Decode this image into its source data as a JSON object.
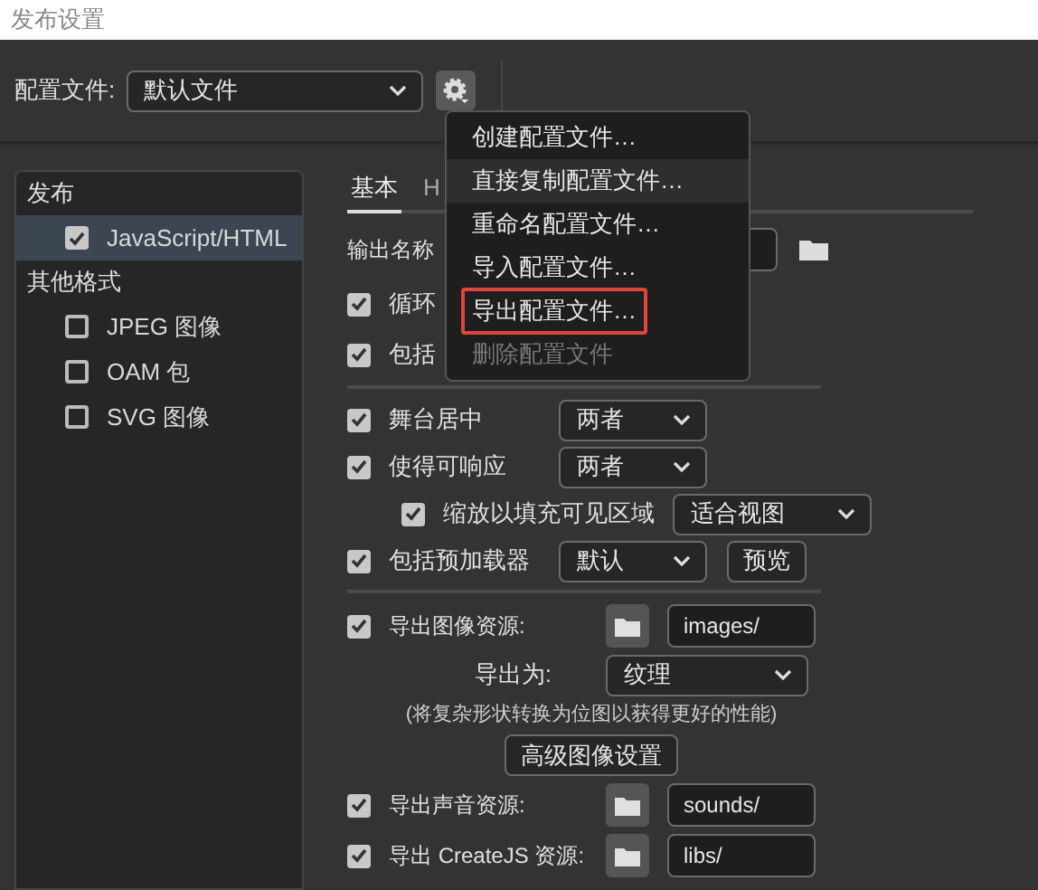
{
  "window": {
    "title": "发布设置"
  },
  "profile": {
    "label": "配置文件:",
    "value": "默认文件"
  },
  "menu": {
    "items": [
      {
        "label": "创建配置文件…",
        "hovered": false,
        "highlighted": false,
        "disabled": false
      },
      {
        "label": "直接复制配置文件…",
        "hovered": true,
        "highlighted": false,
        "disabled": false
      },
      {
        "label": "重命名配置文件…",
        "hovered": false,
        "highlighted": false,
        "disabled": false
      },
      {
        "label": "导入配置文件…",
        "hovered": false,
        "highlighted": false,
        "disabled": false
      },
      {
        "label": "导出配置文件…",
        "hovered": false,
        "highlighted": true,
        "disabled": false
      },
      {
        "label": "删除配置文件",
        "hovered": false,
        "highlighted": false,
        "disabled": true
      }
    ]
  },
  "sidebar": {
    "sections": [
      {
        "title": "发布",
        "items": [
          {
            "label": "JavaScript/HTML",
            "checked": true,
            "selected": true
          }
        ]
      },
      {
        "title": "其他格式",
        "items": [
          {
            "label": "JPEG 图像",
            "checked": false,
            "selected": false
          },
          {
            "label": "OAM 包",
            "checked": false,
            "selected": false
          },
          {
            "label": "SVG 图像",
            "checked": false,
            "selected": false
          }
        ]
      }
    ]
  },
  "tabs": [
    {
      "label": "基本",
      "selected": true
    },
    {
      "label": "H",
      "selected": false
    }
  ],
  "output_name": {
    "label": "输出名称"
  },
  "groups": [
    [
      {
        "kind": "check",
        "label": "循环",
        "checked": true
      },
      {
        "kind": "check",
        "label": "包括",
        "checked": true
      }
    ],
    [
      {
        "kind": "check_select",
        "label": "舞台居中",
        "checked": true,
        "value": "两者"
      },
      {
        "kind": "check_select",
        "label": "使得可响应",
        "checked": true,
        "value": "两者",
        "children": [
          {
            "kind": "check_select",
            "label": "缩放以填充可见区域",
            "checked": true,
            "value": "适合视图"
          }
        ]
      },
      {
        "kind": "check_select",
        "label": "包括预加载器",
        "checked": true,
        "value": "默认",
        "button": "预览"
      }
    ],
    [
      {
        "kind": "check_folder",
        "label": "导出图像资源:",
        "checked": true,
        "path": "images/",
        "children": [
          {
            "kind": "select",
            "label": "导出为:",
            "value": "纹理"
          },
          {
            "kind": "note",
            "label": "(将复杂形状转换为位图以获得更好的性能)"
          },
          {
            "kind": "button",
            "label": "高级图像设置"
          }
        ]
      },
      {
        "kind": "check_folder",
        "label": "导出声音资源:",
        "checked": true,
        "path": "sounds/"
      },
      {
        "kind": "check_folder",
        "label": "导出 CreateJS 资源:",
        "checked": true,
        "path": "libs/"
      }
    ]
  ]
}
